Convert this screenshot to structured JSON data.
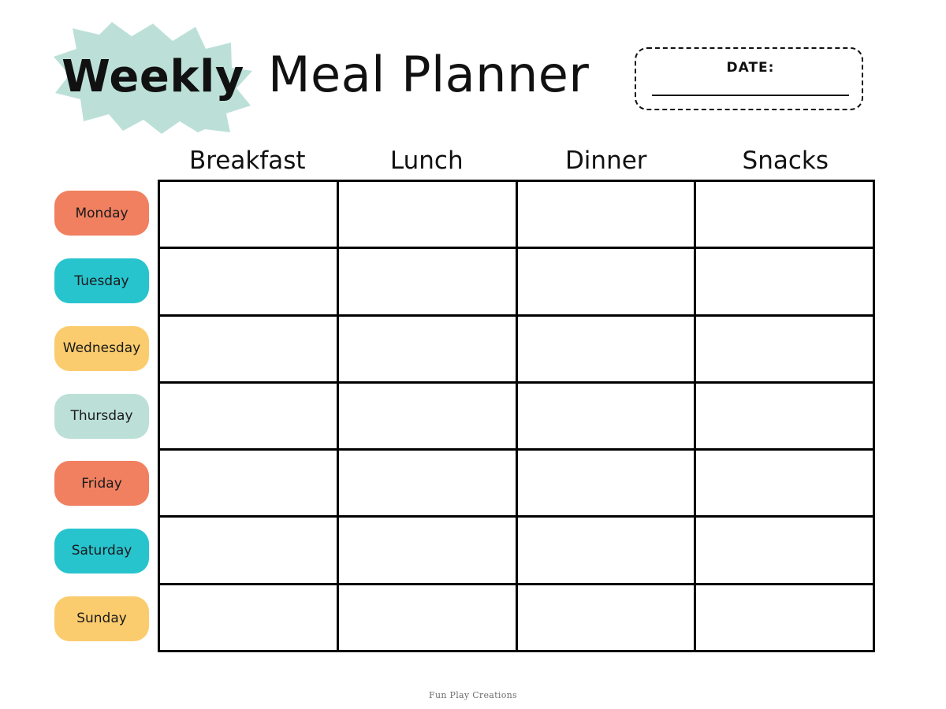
{
  "header": {
    "badge_text": "Weekly",
    "title": "Meal Planner",
    "badge_color": "#BCE0D8",
    "date_label": "DATE:",
    "date_value": ""
  },
  "columns": [
    {
      "label": "Breakfast"
    },
    {
      "label": "Lunch"
    },
    {
      "label": "Dinner"
    },
    {
      "label": "Snacks"
    }
  ],
  "days": [
    {
      "label": "Monday",
      "color": "#F08060"
    },
    {
      "label": "Tuesday",
      "color": "#27C4CE"
    },
    {
      "label": "Wednesday",
      "color": "#FBCC6E"
    },
    {
      "label": "Thursday",
      "color": "#BCE0D8"
    },
    {
      "label": "Friday",
      "color": "#F08060"
    },
    {
      "label": "Saturday",
      "color": "#27C4CE"
    },
    {
      "label": "Sunday",
      "color": "#FBCC6E"
    }
  ],
  "cells": [
    [
      "",
      "",
      "",
      ""
    ],
    [
      "",
      "",
      "",
      ""
    ],
    [
      "",
      "",
      "",
      ""
    ],
    [
      "",
      "",
      "",
      ""
    ],
    [
      "",
      "",
      "",
      ""
    ],
    [
      "",
      "",
      "",
      ""
    ],
    [
      "",
      "",
      "",
      ""
    ]
  ],
  "footer": {
    "credit": "Fun Play Creations"
  },
  "colors": {
    "coral": "#F08060",
    "turquoise": "#27C4CE",
    "yellow": "#FBCC6E",
    "mint": "#BCE0D8",
    "ink": "#111111"
  }
}
